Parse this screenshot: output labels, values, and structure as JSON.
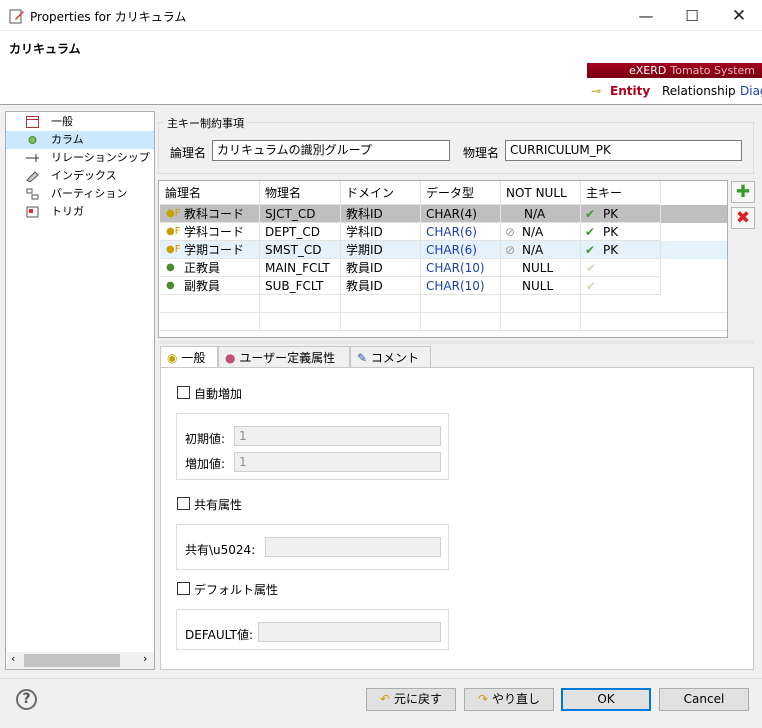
{
  "window": {
    "title": "Properties for カリキュラム"
  },
  "header": {
    "entity_name": "カリキュラム"
  },
  "brand": {
    "name": "eXERD",
    "suffix": "Tomato System",
    "tabs": [
      "Entity",
      "Relationship",
      "Diag"
    ],
    "accent": "#a3001c"
  },
  "tree": {
    "items": [
      "一般",
      "カラム",
      "リレーションシップ",
      "インデックス",
      "パーティション",
      "トリガ"
    ]
  },
  "pk_group": {
    "title": "主キー制約事項",
    "logical_label": "論理名",
    "logical_value": "カリキュラムの識別グループ",
    "physical_label": "物理名",
    "physical_value": "CURRICULUM_PK"
  },
  "grid": {
    "headers": [
      "論理名",
      "物理名",
      "ドメイン",
      "データ型",
      "NOT NULL",
      "主キー"
    ],
    "rows": [
      {
        "logical": "教科コード",
        "physical": "SJCT_CD",
        "domain": "教科ID",
        "type": "CHAR(4)",
        "notnull": "N/A",
        "pk": "PK"
      },
      {
        "logical": "学科コード",
        "physical": "DEPT_CD",
        "domain": "学科ID",
        "type": "CHAR(6)",
        "notnull": "N/A",
        "pk": "PK"
      },
      {
        "logical": "学期コード",
        "physical": "SMST_CD",
        "domain": "学期ID",
        "type": "CHAR(6)",
        "notnull": "N/A",
        "pk": "PK"
      },
      {
        "logical": "正教員",
        "physical": "MAIN_FCLT",
        "domain": "教員ID",
        "type": "CHAR(10)",
        "notnull": "NULL",
        "pk": ""
      },
      {
        "logical": "副教員",
        "physical": "SUB_FCLT",
        "domain": "教員ID",
        "type": "CHAR(10)",
        "notnull": "NULL",
        "pk": ""
      }
    ]
  },
  "tabs": [
    "一般",
    "ユーザー定義属性",
    "コメント"
  ],
  "general": {
    "auto_increment": "自動増加",
    "initial_label": "初期値:",
    "initial_value": "1",
    "increment_label": "増加値:",
    "increment_value": "1",
    "shared_attr": "共有属性",
    "shared_label": "共有\\u5024:",
    "default_attr": "デフォルト属性",
    "default_label": "DEFAULT値:"
  },
  "buttons": {
    "undo": "元に戻す",
    "redo": "やり直し",
    "ok": "OK",
    "cancel": "Cancel"
  }
}
